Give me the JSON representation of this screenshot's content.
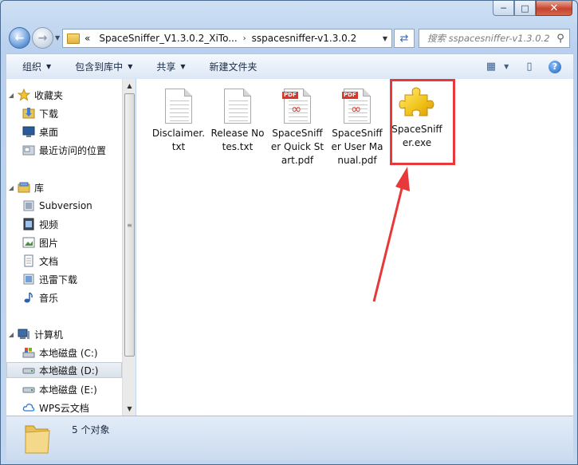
{
  "window": {
    "minimize": "─",
    "maximize": "□",
    "close": "✕"
  },
  "address": {
    "prefix": "«",
    "segment1": "SpaceSniffer_V1.3.0.2_XiTo...",
    "separator": "›",
    "segment2": "sspacesniffer-v1.3.0.2"
  },
  "search": {
    "placeholder": "搜索 sspacesniffer-v1.3.0.2"
  },
  "toolbar": {
    "organize": "组织",
    "include_in_library": "包含到库中",
    "share": "共享",
    "new_folder": "新建文件夹"
  },
  "sidebar": {
    "favorites": "收藏夹",
    "downloads": "下载",
    "desktop": "桌面",
    "recent": "最近访问的位置",
    "libraries": "库",
    "subversion": "Subversion",
    "videos": "视频",
    "pictures": "图片",
    "documents": "文档",
    "xunlei": "迅雷下载",
    "music": "音乐",
    "computer": "计算机",
    "drive_c": "本地磁盘 (C:)",
    "drive_d": "本地磁盘 (D:)",
    "drive_e": "本地磁盘 (E:)",
    "wps": "WPS云文档"
  },
  "files": [
    {
      "name": "Disclaimer.txt",
      "type": "txt"
    },
    {
      "name": "Release Notes.txt",
      "type": "txt"
    },
    {
      "name": "SpaceSniffer Quick Start.pdf",
      "type": "pdf"
    },
    {
      "name": "SpaceSniffer User Manual.pdf",
      "type": "pdf"
    },
    {
      "name": "SpaceSniffer.exe",
      "type": "exe"
    }
  ],
  "pdf_badge": "PDF",
  "status": {
    "count": "5 个对象"
  },
  "colors": {
    "annotation": "#e8383a",
    "selection": "#d9e1ea"
  }
}
